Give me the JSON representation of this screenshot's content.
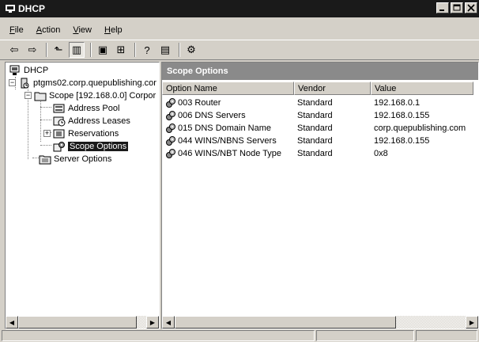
{
  "window": {
    "title": "DHCP",
    "icon": "dhcp-server-icon"
  },
  "menu": [
    {
      "label": "File",
      "accel": "F",
      "rest": "ile"
    },
    {
      "label": "Action",
      "accel": "A",
      "rest": "ction"
    },
    {
      "label": "View",
      "accel": "V",
      "rest": "iew"
    },
    {
      "label": "Help",
      "accel": "H",
      "rest": "elp"
    }
  ],
  "toolbar": {
    "buttons": [
      "back-icon",
      "forward-icon",
      "up-one-level-icon",
      "show-hide-console-tree-icon",
      "properties-icon",
      "refresh-icon",
      "help-icon",
      "export-list-icon",
      "scope-options-icon"
    ],
    "glyphs": {
      "back": "⇦",
      "forward": "⇨",
      "up": "⬑",
      "tree": "▥",
      "props": "▣",
      "refresh": "⊞",
      "help": "?",
      "export": "▤",
      "options": "⚙"
    }
  },
  "tree": {
    "root": "DHCP",
    "server": "ptgms02.corp.quepublishing.cor",
    "scope": "Scope [192.168.0.0] Corpor",
    "children": [
      "Address Pool",
      "Address Leases",
      "Reservations",
      "Scope Options"
    ],
    "server_options": "Server Options",
    "selected": "Scope Options",
    "expander_plus": "+",
    "expander_minus": "−"
  },
  "details": {
    "header": "Scope Options",
    "columns": [
      "Option Name",
      "Vendor",
      "Value"
    ],
    "rows": [
      [
        "003 Router",
        "Standard",
        "192.168.0.1"
      ],
      [
        "006 DNS Servers",
        "Standard",
        "192.168.0.155"
      ],
      [
        "015 DNS Domain Name",
        "Standard",
        "corp.quepublishing.com"
      ],
      [
        "044 WINS/NBNS Servers",
        "Standard",
        "192.168.0.155"
      ],
      [
        "046 WINS/NBT Node Type",
        "Standard",
        "0x8"
      ]
    ]
  },
  "scrollbars": {
    "left_arrow": "◀",
    "right_arrow": "▶"
  },
  "colors": {
    "titlebar": "#1a1a1a",
    "face": "#d4d0c8",
    "header_bar": "#8a8a8a",
    "selection": "#1a1a1a"
  }
}
